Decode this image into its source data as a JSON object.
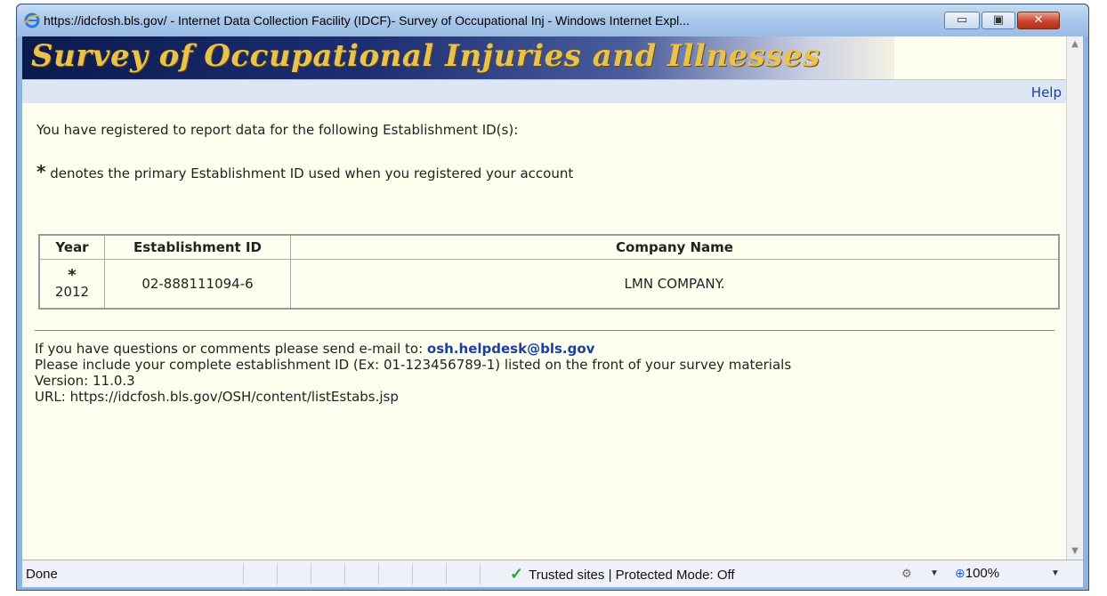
{
  "window": {
    "title": "https://idcfosh.bls.gov/ - Internet Data Collection Facility (IDCF)- Survey of Occupational Inj - Windows Internet Expl...",
    "controls": {
      "minimize": "▭",
      "maximize": "▣",
      "close": "✕"
    }
  },
  "banner": {
    "title": "Survey of Occupational Injuries and Illnesses"
  },
  "nav": {
    "help": "Help"
  },
  "intro": "You have registered to report data for the following Establishment ID(s):",
  "note": {
    "star": "*",
    "text": " denotes the primary Establishment ID used when you registered your account"
  },
  "table": {
    "headers": {
      "year": "Year",
      "establishment_id": "Establishment ID",
      "company_name": "Company Name"
    },
    "rows": [
      {
        "star": "*",
        "year": "2012",
        "establishment_id": "02-888111094-6",
        "company_name": "LMN COMPANY."
      }
    ]
  },
  "footer": {
    "contact_prefix": "If you have questions or comments please send e-mail to: ",
    "email": "osh.helpdesk@bls.gov",
    "include_note": "Please include your complete establishment ID (Ex: 01-123456789-1) listed on the front of your survey materials",
    "version": "Version: 11.0.3",
    "url": "URL: https://idcfosh.bls.gov/OSH/content/listEstabs.jsp"
  },
  "status": {
    "state": "Done",
    "zone": "Trusted sites | Protected Mode: Off",
    "zoom": "100%"
  },
  "colors": {
    "help_link": "#1a3ea8",
    "banner_text": "#e8c24a",
    "page_bg": "#fffff0"
  },
  "icons": [
    "ie-logo-icon",
    "minimize-icon",
    "maximize-icon",
    "close-icon",
    "scroll-up-icon",
    "scroll-down-icon",
    "trusted-check-icon",
    "protected-mode-icon",
    "zoom-icon",
    "chevron-down-icon"
  ]
}
